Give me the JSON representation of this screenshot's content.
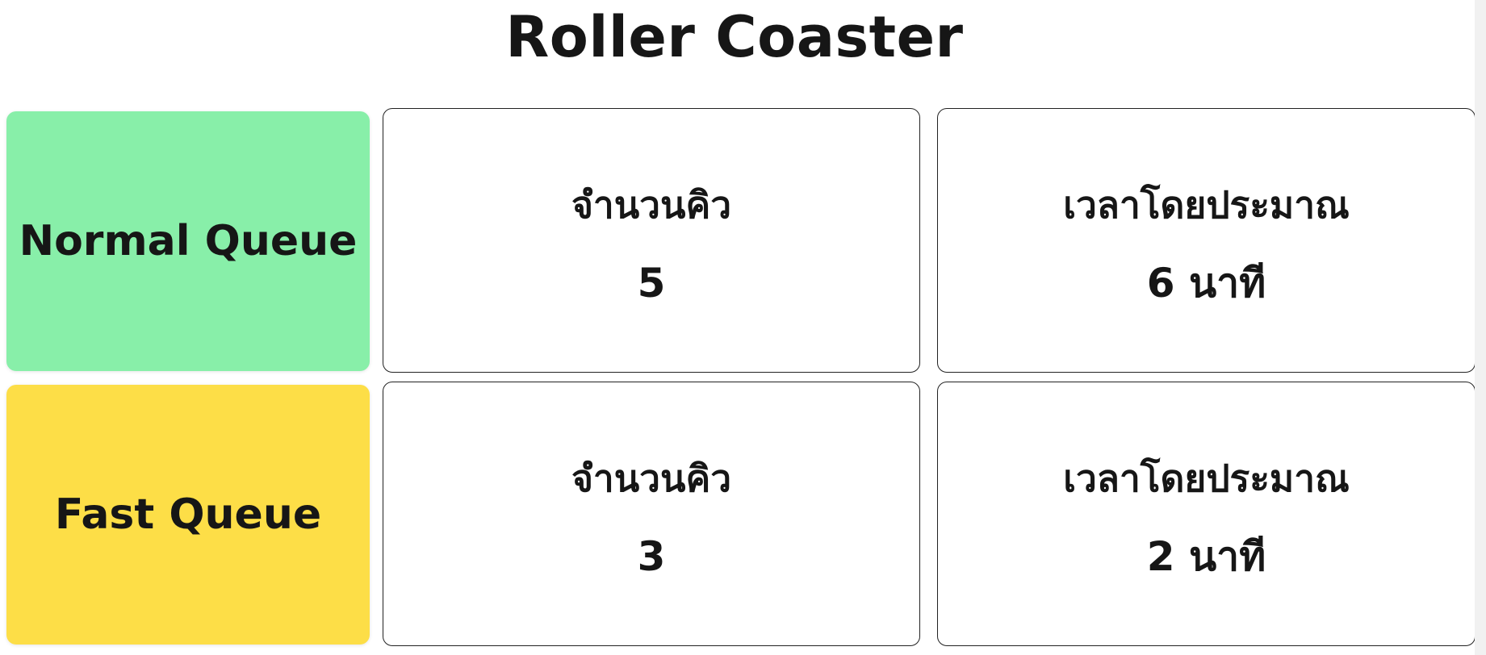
{
  "page": {
    "title": "Roller Coaster"
  },
  "queues": [
    {
      "label": "Normal Queue",
      "color": "#88EFA9",
      "count_caption": "จำนวนคิว",
      "count_value": "5",
      "time_caption": "เวลาโดยประมาณ",
      "time_value": "6 นาที"
    },
    {
      "label": "Fast Queue",
      "color": "#FDDE47",
      "count_caption": "จำนวนคิว",
      "count_value": "3",
      "time_caption": "เวลาโดยประมาณ",
      "time_value": "2 นาที"
    }
  ]
}
